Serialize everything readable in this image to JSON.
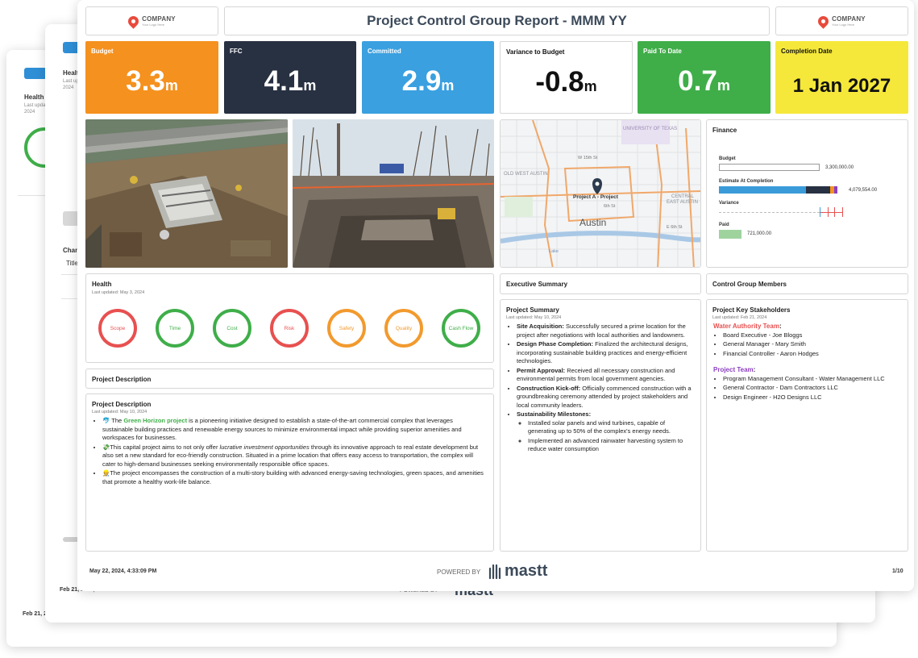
{
  "back_pages": {
    "page3": {
      "health_title": "Health",
      "health_sub": "Last updat",
      "year": "2024",
      "footer_date": "Feb 21, 2"
    },
    "page2": {
      "health_title": "Healt",
      "health_sub": "Last up",
      "year": "2024",
      "changes_title": "Chan",
      "col_title": "Title",
      "footer_date": "Feb 21, 2024, 03:24 PM",
      "footer_powered": "POWERED BY",
      "footer_brand": "mastt",
      "footer_page": "3/10"
    }
  },
  "header": {
    "company_name": "COMPANY",
    "company_tagline": "Your Logo Here",
    "title": "Project Control Group Report - MMM YY"
  },
  "kpis": [
    {
      "label": "Budget",
      "value": "3.3",
      "unit": "m",
      "bg": "#f5911e",
      "fg": "#ffffff"
    },
    {
      "label": "FFC",
      "value": "4.1",
      "unit": "m",
      "bg": "#283142",
      "fg": "#ffffff"
    },
    {
      "label": "Committed",
      "value": "2.9",
      "unit": "m",
      "bg": "#3aa0e0",
      "fg": "#ffffff"
    },
    {
      "label": "Variance to Budget",
      "value": "-0.8",
      "unit": "m",
      "bg": "#ffffff",
      "fg": "#111111"
    },
    {
      "label": "Paid To Date",
      "value": "0.7",
      "unit": "m",
      "bg": "#3fae49",
      "fg": "#ffffff"
    },
    {
      "label": "Completion Date",
      "value": "1 Jan 2027",
      "unit": "",
      "bg": "#f5e83a",
      "fg": "#111111"
    }
  ],
  "map": {
    "labels": {
      "university": "UNIVERSITY OF TEXAS",
      "old_west": "OLD WEST AUSTIN",
      "central": "CENTRAL",
      "east_austin": "EAST AUSTIN",
      "project": "Project A - Project",
      "city": "Austin",
      "street_w15": "W 15th St",
      "street_e6": "E 6th St",
      "street_6th": "6th St",
      "street_lake": "Lake"
    }
  },
  "finance": {
    "title": "Finance",
    "rows": [
      {
        "label": "Budget",
        "value": "3,300,000.00"
      },
      {
        "label": "Estimate At Completion",
        "value": "4,079,554.00"
      },
      {
        "label": "Variance",
        "value": ""
      },
      {
        "label": "Paid",
        "value": "721,000.00"
      }
    ],
    "colors": {
      "eac_main": "#3a9bd8",
      "eac_dark": "#283142",
      "eac_orange": "#f5911e",
      "eac_purple": "#8b3fc0",
      "variance": "#3a9bd8",
      "variance_red": "#e85050",
      "paid": "#9fd39e"
    }
  },
  "health": {
    "title": "Health",
    "updated": "Last updated: May 3, 2024",
    "items": [
      {
        "label": "Scope",
        "status": "red"
      },
      {
        "label": "Time",
        "status": "green"
      },
      {
        "label": "Cost",
        "status": "green"
      },
      {
        "label": "Risk",
        "status": "red"
      },
      {
        "label": "Safety",
        "status": "orange"
      },
      {
        "label": "Quality",
        "status": "orange"
      },
      {
        "label": "Cash Flow",
        "status": "green"
      }
    ]
  },
  "executive_summary": {
    "header": "Executive Summary",
    "title": "Project Summary",
    "updated": "Last updated: May 10, 2024",
    "items": [
      {
        "bold": "Site Acquisition:",
        "text": " Successfully secured a prime location for the project after negotiations with local authorities and landowners."
      },
      {
        "bold": "Design Phase Completion:",
        "text": " Finalized the architectural designs, incorporating sustainable building practices and energy-efficient technologies."
      },
      {
        "bold": "Permit Approval:",
        "text": " Received all necessary construction and environmental permits from local government agencies."
      },
      {
        "bold": "Construction Kick-off:",
        "text": " Officially commenced construction with a groundbreaking ceremony attended by project stakeholders and local community leaders."
      },
      {
        "bold": "Sustainability Milestones:",
        "text": ""
      }
    ],
    "sub_items": [
      "Installed solar panels and wind turbines, capable of generating up to 50% of the complex's energy needs.",
      "Implemented an advanced rainwater harvesting system to reduce water consumption"
    ]
  },
  "control_group": {
    "header": "Control Group Members",
    "title": "Project Key Stakeholders",
    "updated": "Last updated: Feb 21, 2024",
    "water_team_label": "Water Authority Team",
    "water_team_color": "#e85050",
    "water_team": [
      "Board Executive - Joe Bloggs",
      "General Manager - Mary Smith",
      "Financial Controller - Aaron Hodges"
    ],
    "project_team_label": "Project Team",
    "project_team_color": "#8b3fc0",
    "project_team": [
      "Program Management Consultant - Water Management LLC",
      "General Contractor - Dam Contractors LLC",
      "Design Engineer - H2O Designs LLC"
    ]
  },
  "project_description": {
    "header": "Project Description",
    "title": "Project Description",
    "updated": "Last updated: May 10, 2024",
    "p1_pre": "The ",
    "p1_link": "Green Horizon project",
    "p1_post": " is a pioneering initiative designed to establish a state-of-the-art commercial complex that leverages sustainable building practices and renewable energy sources to minimize environmental impact while providing superior amenities and workspaces for businesses.",
    "p2_pre": "This capital project aims to not only offer ",
    "p2_em": "lucrative investment opportunities",
    "p2_post": " through its innovative approach to real estate development but also set a new standard for eco-friendly construction. Situated in a prime location that offers easy access to transportation, the complex will cater to high-demand businesses seeking environmentally responsible office spaces.",
    "p3": "The project encompasses the construction of a multi-story building with advanced energy-saving technologies, green spaces, and amenities that promote a healthy work-life balance.",
    "link_color": "#3fae49"
  },
  "footer": {
    "date": "May 22, 2024, 4:33:09 PM",
    "powered": "POWERED BY",
    "brand": "mastt",
    "page": "1/10"
  }
}
